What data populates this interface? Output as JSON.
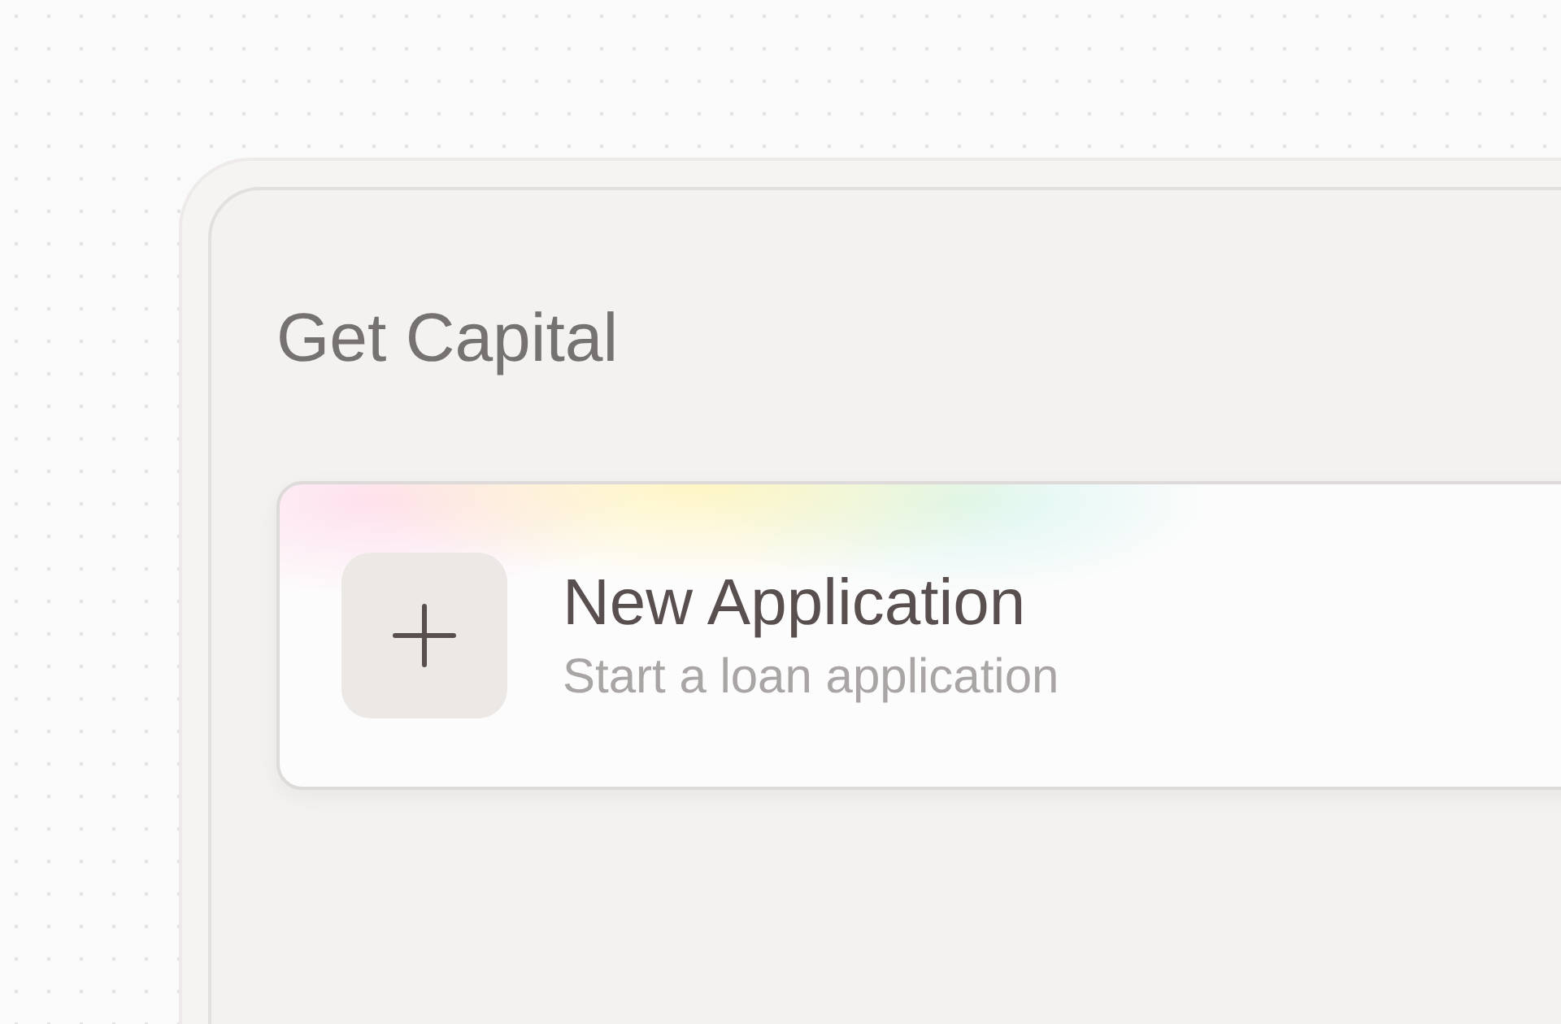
{
  "title": "Get Capital",
  "action": {
    "title": "New Application",
    "subtitle": "Start a loan application"
  }
}
